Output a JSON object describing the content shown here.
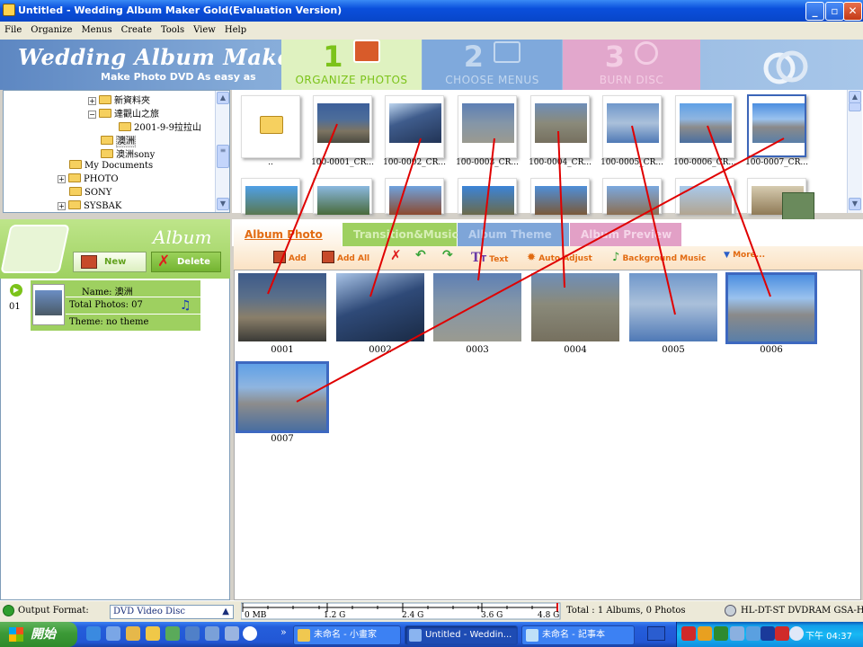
{
  "window": {
    "title": "Untitled - Wedding Album Maker Gold(Evaluation Version)"
  },
  "menu": [
    "File",
    "Organize",
    "Menus",
    "Create",
    "Tools",
    "View",
    "Help"
  ],
  "banner": {
    "logo": "Wedding Album Maker Gold",
    "tagline": "Make Photo DVD As easy as",
    "steps": [
      {
        "num": "1",
        "label": "ORGANIZE PHOTOS"
      },
      {
        "num": "2",
        "label": "CHOOSE MENUS"
      },
      {
        "num": "3",
        "label": "BURN  DISC"
      }
    ]
  },
  "tree": {
    "items": [
      "新資料夾",
      "達觀山之旅",
      "2001-9-9拉拉山",
      "澳洲",
      "澳洲sony",
      "My Documents",
      "PHOTO",
      "SONY",
      "SYSBAK"
    ]
  },
  "browser": {
    "labels": [
      "..",
      "100-0001_CR...",
      "100-0002_CR...",
      "100-0003_CR...",
      "100-0004_CR...",
      "100-0005_CR...",
      "100-0006_CR...",
      "100-0007_CR..."
    ]
  },
  "album": {
    "title": "Album",
    "new_label": "New",
    "delete_label": "Delete",
    "index": "01",
    "name": "Name: 澳洲",
    "total": "Total Photos: 07",
    "theme": "Theme: no theme"
  },
  "tabs": [
    "Album Photo",
    "Transition&Music",
    "Album Theme",
    "Album Preview"
  ],
  "toolbar": {
    "add": "Add",
    "add_all": "Add All",
    "text": "Text",
    "auto_adjust": "Auto Adjust",
    "background_music": "Background Music",
    "more": "More..."
  },
  "photos": [
    "0001",
    "0002",
    "0003",
    "0004",
    "0005",
    "0006",
    "0007"
  ],
  "status": {
    "output_label": "Output Format:",
    "output_value": "DVD Video Disc",
    "ticks": [
      "0 MB",
      "1.2 G",
      "2.4 G",
      "3.6 G",
      "4.8 G"
    ],
    "total": "Total : 1 Albums, 0 Photos",
    "drive": "HL-DT-ST DVDRAM GSA-H"
  },
  "taskbar": {
    "start": "開始",
    "tasks": [
      "未命名 - 小畫家",
      "Untitled - Weddin...",
      "未命名 - 記事本"
    ],
    "clock": "下午 04:37"
  },
  "colors": {
    "title_bar": "#0a4fdc",
    "accent_green": "#9ed060",
    "accent_orange": "#e26b12",
    "annotation_red": "#e00000"
  }
}
